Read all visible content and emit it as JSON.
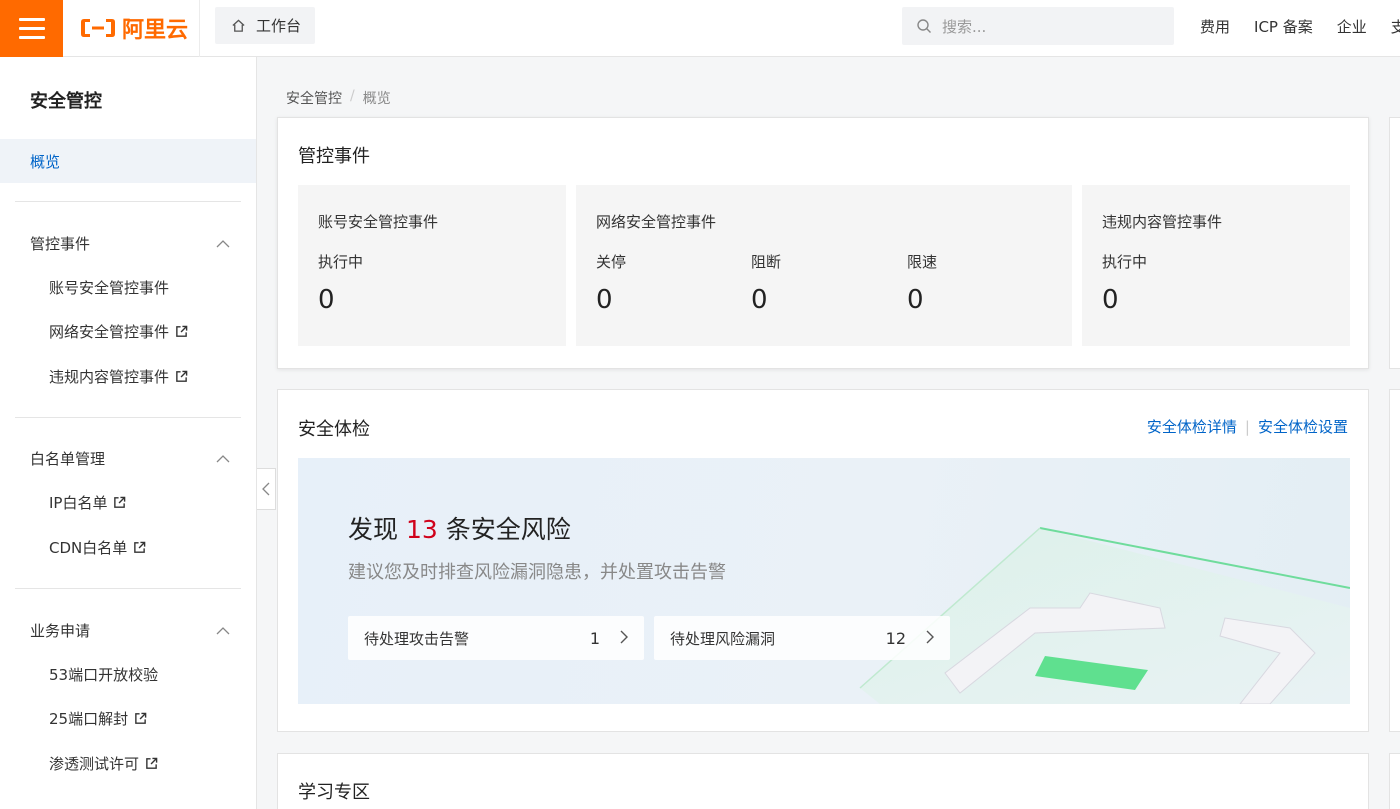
{
  "brand": {
    "name": "阿里云",
    "accent": "#ff6a00",
    "link_color": "#0064c8",
    "alert_color": "#d0021b"
  },
  "topbar": {
    "workbench_label": "工作台",
    "search_placeholder": "搜索...",
    "links": [
      "费用",
      "ICP 备案",
      "企业",
      "支"
    ]
  },
  "sidebar": {
    "title": "安全管控",
    "overview": "概览",
    "groups": [
      {
        "label": "管控事件",
        "items": [
          {
            "label": "账号安全管控事件",
            "external": false
          },
          {
            "label": "网络安全管控事件",
            "external": true
          },
          {
            "label": "违规内容管控事件",
            "external": true
          }
        ]
      },
      {
        "label": "白名单管理",
        "items": [
          {
            "label": "IP白名单",
            "external": true
          },
          {
            "label": "CDN白名单",
            "external": true
          }
        ]
      },
      {
        "label": "业务申请",
        "items": [
          {
            "label": "53端口开放校验",
            "external": false
          },
          {
            "label": "25端口解封",
            "external": true
          },
          {
            "label": "渗透测试许可",
            "external": true
          }
        ]
      }
    ]
  },
  "breadcrumb": {
    "root": "安全管控",
    "sep": "/",
    "current": "概览"
  },
  "control_events": {
    "title": "管控事件",
    "account": {
      "title": "账号安全管控事件",
      "label": "执行中",
      "value": "0"
    },
    "network": {
      "title": "网络安全管控事件",
      "metrics": [
        {
          "label": "关停",
          "value": "0"
        },
        {
          "label": "阻断",
          "value": "0"
        },
        {
          "label": "限速",
          "value": "0"
        }
      ]
    },
    "content": {
      "title": "违规内容管控事件",
      "label": "执行中",
      "value": "0"
    }
  },
  "security_check": {
    "title": "安全体检",
    "details_link": "安全体检详情",
    "settings_link": "安全体检设置",
    "divider": "|",
    "headline_prefix": "发现",
    "risk_count": "13",
    "headline_suffix": "条安全风险",
    "subtitle": "建议您及时排查风险漏洞隐患，并处置攻击告警",
    "pending_alerts": {
      "label": "待处理攻击告警",
      "count": "1"
    },
    "pending_vulns": {
      "label": "待处理风险漏洞",
      "count": "12"
    }
  },
  "learning": {
    "title": "学习专区"
  }
}
